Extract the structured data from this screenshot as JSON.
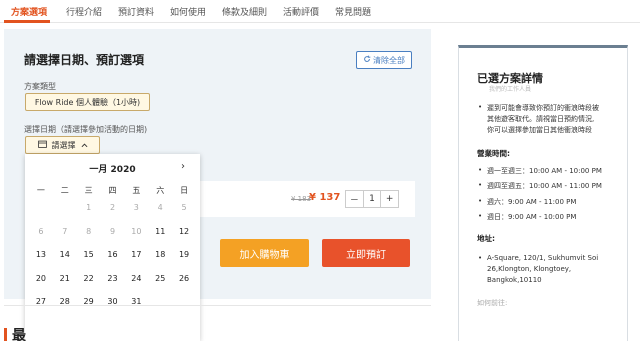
{
  "nav": {
    "tabs": [
      {
        "label": "方案選項",
        "active": true
      },
      {
        "label": "行程介紹"
      },
      {
        "label": "預訂資料"
      },
      {
        "label": "如何使用"
      },
      {
        "label": "條款及細則"
      },
      {
        "label": "活動評價"
      },
      {
        "label": "常見問題"
      }
    ]
  },
  "booking": {
    "title": "請選擇日期、預訂選項",
    "clear_label": "清除全部",
    "plan_type_label": "方案類型",
    "plan_selected": "Flow Ride 個人體驗（1小時)",
    "date_label": "選擇日期（請選擇參加活動的日期)",
    "date_button": "請選擇",
    "price_old": "¥ 183",
    "price_new": "¥ 137",
    "quantity": {
      "minus": "－",
      "value": "1",
      "plus": "+"
    },
    "cart_button": "加入購物車",
    "book_button": "立即預訂"
  },
  "calendar": {
    "month": "一月 2020",
    "next_icon": "›",
    "weekdays": [
      "一",
      "二",
      "三",
      "四",
      "五",
      "六",
      "日"
    ],
    "weeks": [
      [
        {
          "d": ""
        },
        {
          "d": ""
        },
        {
          "d": "1",
          "disabled": true
        },
        {
          "d": "2",
          "disabled": true
        },
        {
          "d": "3",
          "disabled": true
        },
        {
          "d": "4",
          "disabled": true
        },
        {
          "d": "5",
          "disabled": true
        }
      ],
      [
        {
          "d": "6",
          "disabled": true
        },
        {
          "d": "7",
          "disabled": true
        },
        {
          "d": "8",
          "disabled": true
        },
        {
          "d": "9",
          "disabled": true
        },
        {
          "d": "10",
          "disabled": true
        },
        {
          "d": "11"
        },
        {
          "d": "12"
        }
      ],
      [
        {
          "d": "13"
        },
        {
          "d": "14"
        },
        {
          "d": "15"
        },
        {
          "d": "16"
        },
        {
          "d": "17"
        },
        {
          "d": "18"
        },
        {
          "d": "19"
        }
      ],
      [
        {
          "d": "20"
        },
        {
          "d": "21"
        },
        {
          "d": "22"
        },
        {
          "d": "23"
        },
        {
          "d": "24"
        },
        {
          "d": "25"
        },
        {
          "d": "26"
        }
      ],
      [
        {
          "d": "27"
        },
        {
          "d": "28"
        },
        {
          "d": "29"
        },
        {
          "d": "30"
        },
        {
          "d": "31"
        },
        {
          "d": ""
        },
        {
          "d": ""
        }
      ]
    ]
  },
  "summary": {
    "title": "已選方案詳情",
    "faded_text": "我們的工作人員",
    "note_lines": [
      "遲到可能會導致你預訂的衝浪時段被",
      "其他遊客取代。請視當日預約情況,",
      "你可以選擇參加當日其他衝浪時段"
    ],
    "hours_label": "營業時間:",
    "hours": [
      "週一至週三：10:00 AM - 10:00 PM",
      "週四至週五：10:00 AM - 11:00 PM",
      "週六：9:00 AM - 11:00 PM",
      "週日：9:00 AM - 10:00 PM"
    ],
    "address_label": "地址:",
    "address_lines": [
      "A-Square, 120/1, Sukhumvit Soi",
      "26,Klongton, Klongtoey,",
      "Bangkok,10110"
    ],
    "directions": "如何前往:"
  },
  "bottom": {
    "heading": "最"
  },
  "colors": {
    "accent": "#e2531f",
    "cart": "#f4a124",
    "book": "#e8522b",
    "link": "#4a7fc1",
    "chip_bg": "#fff8e3",
    "panel_bg": "#eef3f7"
  }
}
